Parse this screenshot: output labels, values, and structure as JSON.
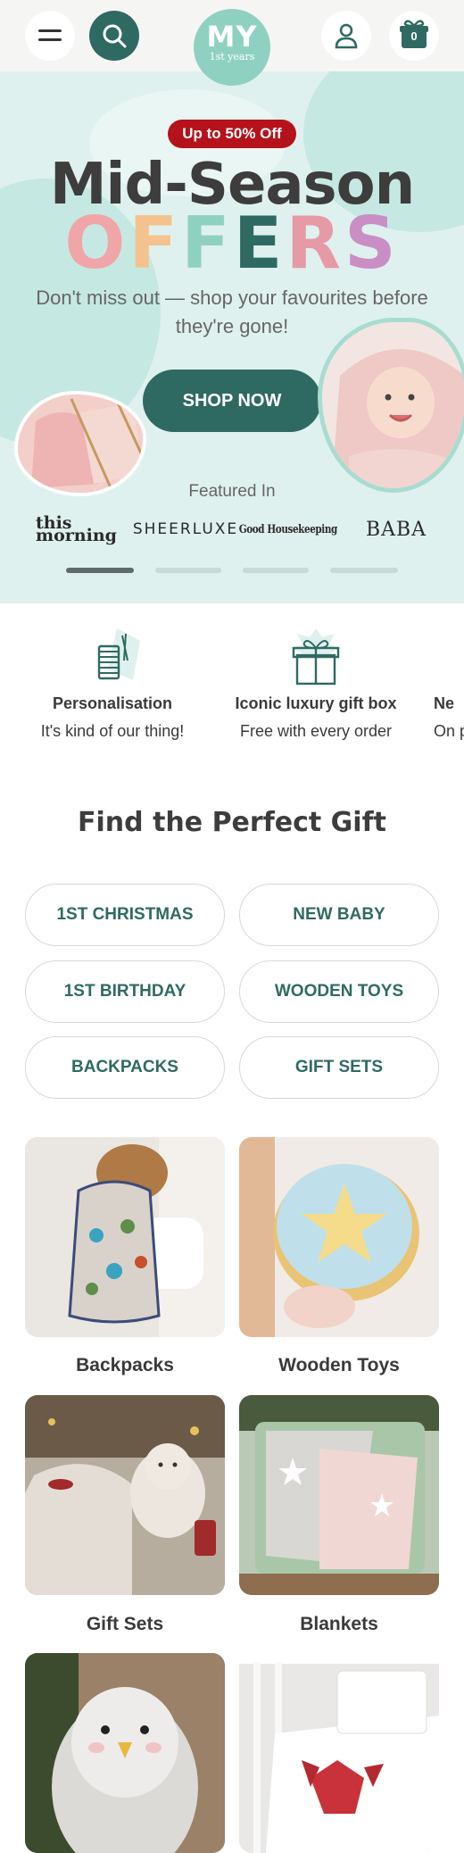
{
  "header": {
    "logo_main": "MY",
    "logo_sub": "1st years",
    "basket_count": "0",
    "icons": [
      "menu-icon",
      "search-icon",
      "account-icon",
      "basket-icon"
    ]
  },
  "hero": {
    "badge": "Up to 50% Off",
    "title": "Mid-Season",
    "offers_letters": [
      "O",
      "F",
      "F",
      "E",
      "R",
      "S"
    ],
    "offers_colors": [
      "#f0a5a8",
      "#f4c28e",
      "#8fd1c1",
      "#2f6a62",
      "#e59aa6",
      "#c98fc4"
    ],
    "subtitle": "Don't miss out — shop your favourites before they're gone!",
    "cta": "SHOP NOW",
    "featured_label": "Featured In",
    "press": [
      "this morning",
      "SHEERLUXE",
      "Good Housekeeping",
      "BABA"
    ],
    "slides_total": 4,
    "slide_active": 1
  },
  "usps": [
    {
      "title": "Personalisation",
      "subtitle": "It's kind of our thing!"
    },
    {
      "title": "Iconic luxury gift box",
      "subtitle": "Free with every order"
    },
    {
      "title": "Ne",
      "subtitle": "On p"
    }
  ],
  "gift_finder": {
    "title": "Find the Perfect Gift",
    "pills": [
      "1ST CHRISTMAS",
      "NEW BABY",
      "1ST BIRTHDAY",
      "WOODEN TOYS",
      "BACKPACKS",
      "GIFT SETS"
    ]
  },
  "categories": [
    {
      "label": "Backpacks"
    },
    {
      "label": "Wooden Toys"
    },
    {
      "label": "Gift Sets"
    },
    {
      "label": "Blankets"
    },
    {
      "label": ""
    },
    {
      "label": ""
    }
  ],
  "colors": {
    "brand_teal": "#2f6a62",
    "mint": "#8fd1c1",
    "sale_red": "#b5121b",
    "hero_bg": "#dff1ee"
  }
}
